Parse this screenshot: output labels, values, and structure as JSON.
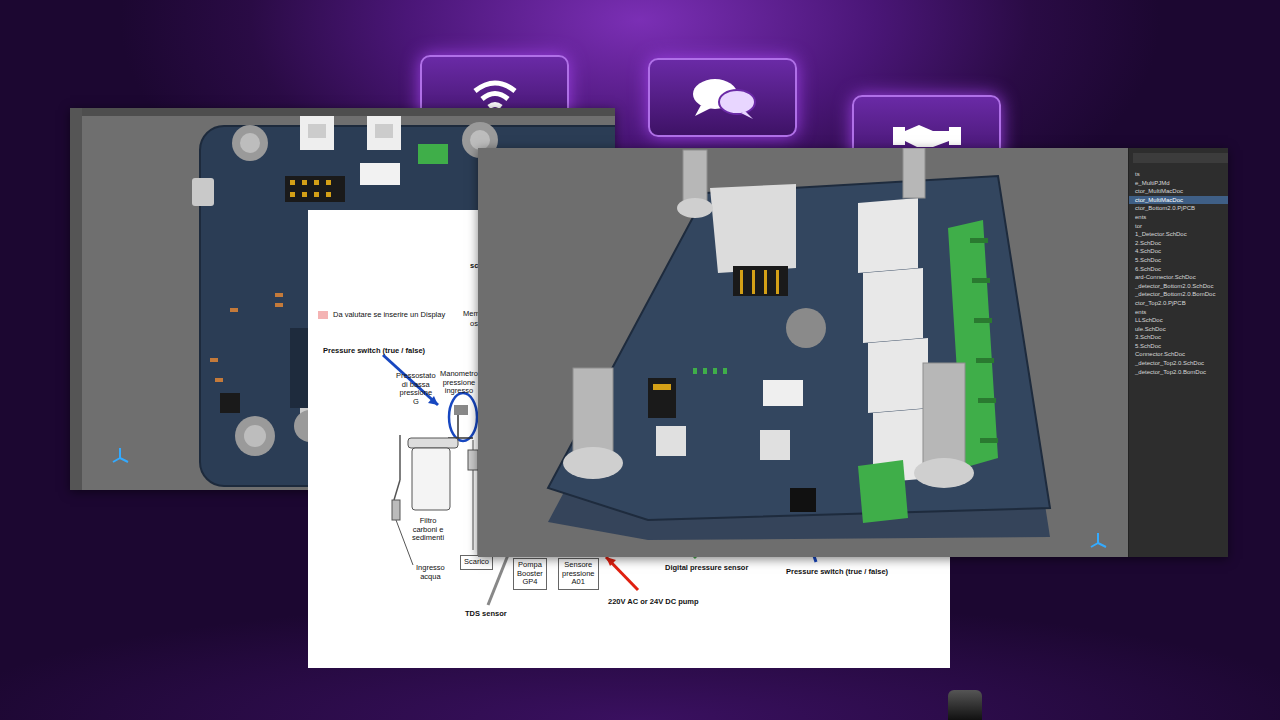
{
  "document": {
    "legend": "Da valutare se inserire un Display",
    "labels": [
      {
        "text": "sc",
        "kind": "bold"
      },
      {
        "text": "Mem",
        "kind": "plain"
      },
      {
        "text": "osi",
        "kind": "plain"
      },
      {
        "text": "Pressure switch (true / false)",
        "kind": "bold"
      },
      {
        "text": "Pressostato\ndi bassa\npressione\nG",
        "kind": "center"
      },
      {
        "text": "Manometro\npressione\ningresso",
        "kind": "center"
      },
      {
        "text": "Filtro\ncarboni e\nsedimenti",
        "kind": "center"
      },
      {
        "text": "Ingresso\nacqua",
        "kind": "center"
      },
      {
        "text": "Scarico",
        "kind": "box"
      },
      {
        "text": "Pompa\nBooster\nGP4",
        "kind": "box"
      },
      {
        "text": "Sensore\npressione\nA01",
        "kind": "box"
      },
      {
        "text": "Digital pressure sensor",
        "kind": "bold"
      },
      {
        "text": "Pressure switch (true / false)",
        "kind": "bold"
      },
      {
        "text": "220V AC or 24V DC pump",
        "kind": "bold"
      },
      {
        "text": "TDS sensor",
        "kind": "bold"
      }
    ]
  },
  "tree": {
    "items": [
      {
        "label": "ts",
        "selected": false
      },
      {
        "label": "e_MultiPJMd",
        "selected": false
      },
      {
        "label": "ctor_MultiMacDoc",
        "selected": false
      },
      {
        "label": "ctor_MultiMacDoc",
        "selected": true
      },
      {
        "label": "ctor_Bottom2.0.PjPCB",
        "selected": false
      },
      {
        "label": "ents",
        "selected": false
      },
      {
        "label": "tor",
        "selected": false
      },
      {
        "label": "1_Detector.SchDoc",
        "selected": false
      },
      {
        "label": "2.SchDoc",
        "selected": false
      },
      {
        "label": "4.SchDoc",
        "selected": false
      },
      {
        "label": "5.SchDoc",
        "selected": false
      },
      {
        "label": "6.SchDoc",
        "selected": false
      },
      {
        "label": "ard-Connector.SchDoc",
        "selected": false
      },
      {
        "label": "_detector_Bottom2.0.SchDoc",
        "selected": false
      },
      {
        "label": "_detector_Bottom2.0.BomDoc",
        "selected": false
      },
      {
        "label": "ctor_Top2.0.PjPCB",
        "selected": false
      },
      {
        "label": "ents",
        "selected": false
      },
      {
        "label": "LLSchDoc",
        "selected": false
      },
      {
        "label": "ule.SchDoc",
        "selected": false
      },
      {
        "label": "3.SchDoc",
        "selected": false
      },
      {
        "label": "5.SchDoc",
        "selected": false
      },
      {
        "label": "Connector.SchDoc",
        "selected": false
      },
      {
        "label": "_detector_Top2.0.SchDoc",
        "selected": false
      },
      {
        "label": "_detector_Top2.0.BomDoc",
        "selected": false
      }
    ]
  }
}
